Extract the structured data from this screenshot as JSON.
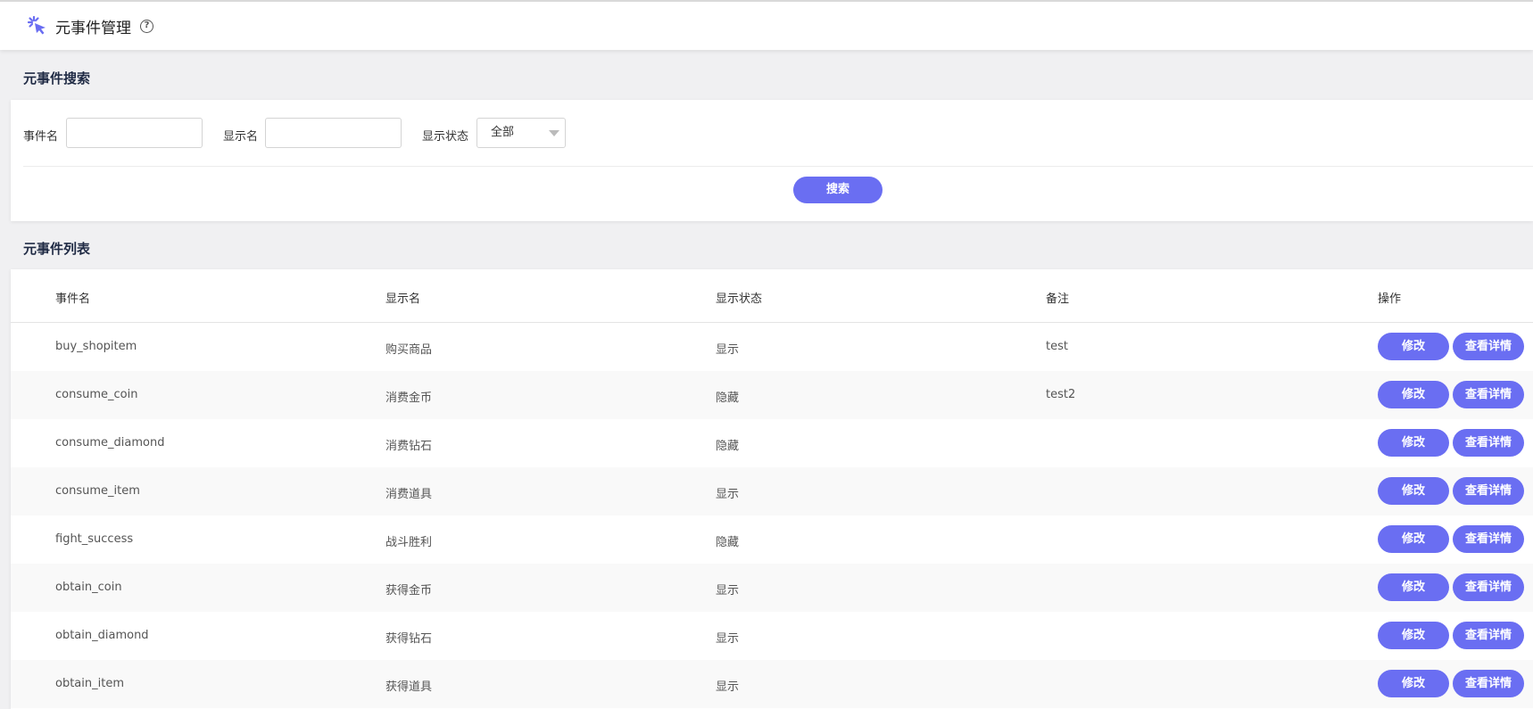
{
  "header": {
    "title": "元事件管理",
    "help": "?"
  },
  "search": {
    "section_title": "元事件搜索",
    "event_name_label": "事件名",
    "event_name_value": "",
    "display_name_label": "显示名",
    "display_name_value": "",
    "status_label": "显示状态",
    "status_selected": "全部",
    "button_label": "搜索"
  },
  "list": {
    "section_title": "元事件列表",
    "columns": [
      "事件名",
      "显示名",
      "显示状态",
      "备注",
      "操作"
    ],
    "edit_label": "修改",
    "detail_label": "查看详情",
    "rows": [
      {
        "event": "buy_shopitem",
        "display": "购买商品",
        "status": "显示",
        "note": "test"
      },
      {
        "event": "consume_coin",
        "display": "消费金币",
        "status": "隐藏",
        "note": "test2"
      },
      {
        "event": "consume_diamond",
        "display": "消费钻石",
        "status": "隐藏",
        "note": ""
      },
      {
        "event": "consume_item",
        "display": "消费道具",
        "status": "显示",
        "note": ""
      },
      {
        "event": "fight_success",
        "display": "战斗胜利",
        "status": "隐藏",
        "note": ""
      },
      {
        "event": "obtain_coin",
        "display": "获得金币",
        "status": "显示",
        "note": ""
      },
      {
        "event": "obtain_diamond",
        "display": "获得钻石",
        "status": "显示",
        "note": ""
      },
      {
        "event": "obtain_item",
        "display": "获得道具",
        "status": "显示",
        "note": ""
      }
    ]
  },
  "colors": {
    "accent": "#6a6ef2"
  },
  "icons": {
    "logo": "sparkle-cursor-icon",
    "help": "question-circle-icon",
    "dropdown": "caret-down-icon"
  }
}
